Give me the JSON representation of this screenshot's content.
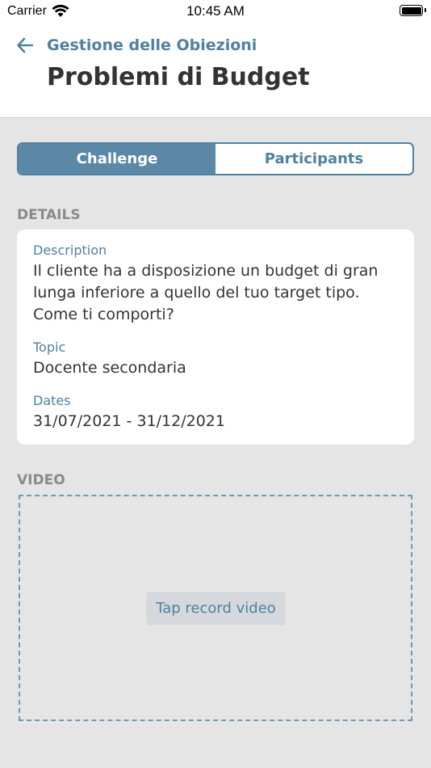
{
  "status_bar": {
    "carrier": "Carrier",
    "time": "10:45 AM",
    "wifi_icon": "wifi-icon",
    "battery_icon": "battery-icon"
  },
  "nav": {
    "back_label": "Gestione delle Obiezioni",
    "back_icon": "arrow-left-icon",
    "title": "Problemi di Budget"
  },
  "tabs": [
    {
      "label": "Challenge",
      "active": true
    },
    {
      "label": "Participants",
      "active": false
    }
  ],
  "details": {
    "section_label": "DETAILS",
    "description_label": "Description",
    "description": "Il cliente ha a disposizione un budget di gran lunga inferiore a quello del tuo target tipo. Come ti comporti?",
    "topic_label": "Topic",
    "topic": "Docente secondaria",
    "dates_label": "Dates",
    "dates": "31/07/2021 - 31/12/2021"
  },
  "video": {
    "section_label": "VIDEO",
    "record_label": "Tap record video"
  },
  "colors": {
    "accent": "#4e81a0",
    "accent_fill": "#5b88a6",
    "background": "#e5e5e5",
    "card": "#ffffff",
    "section_label": "#8a8a8a"
  }
}
